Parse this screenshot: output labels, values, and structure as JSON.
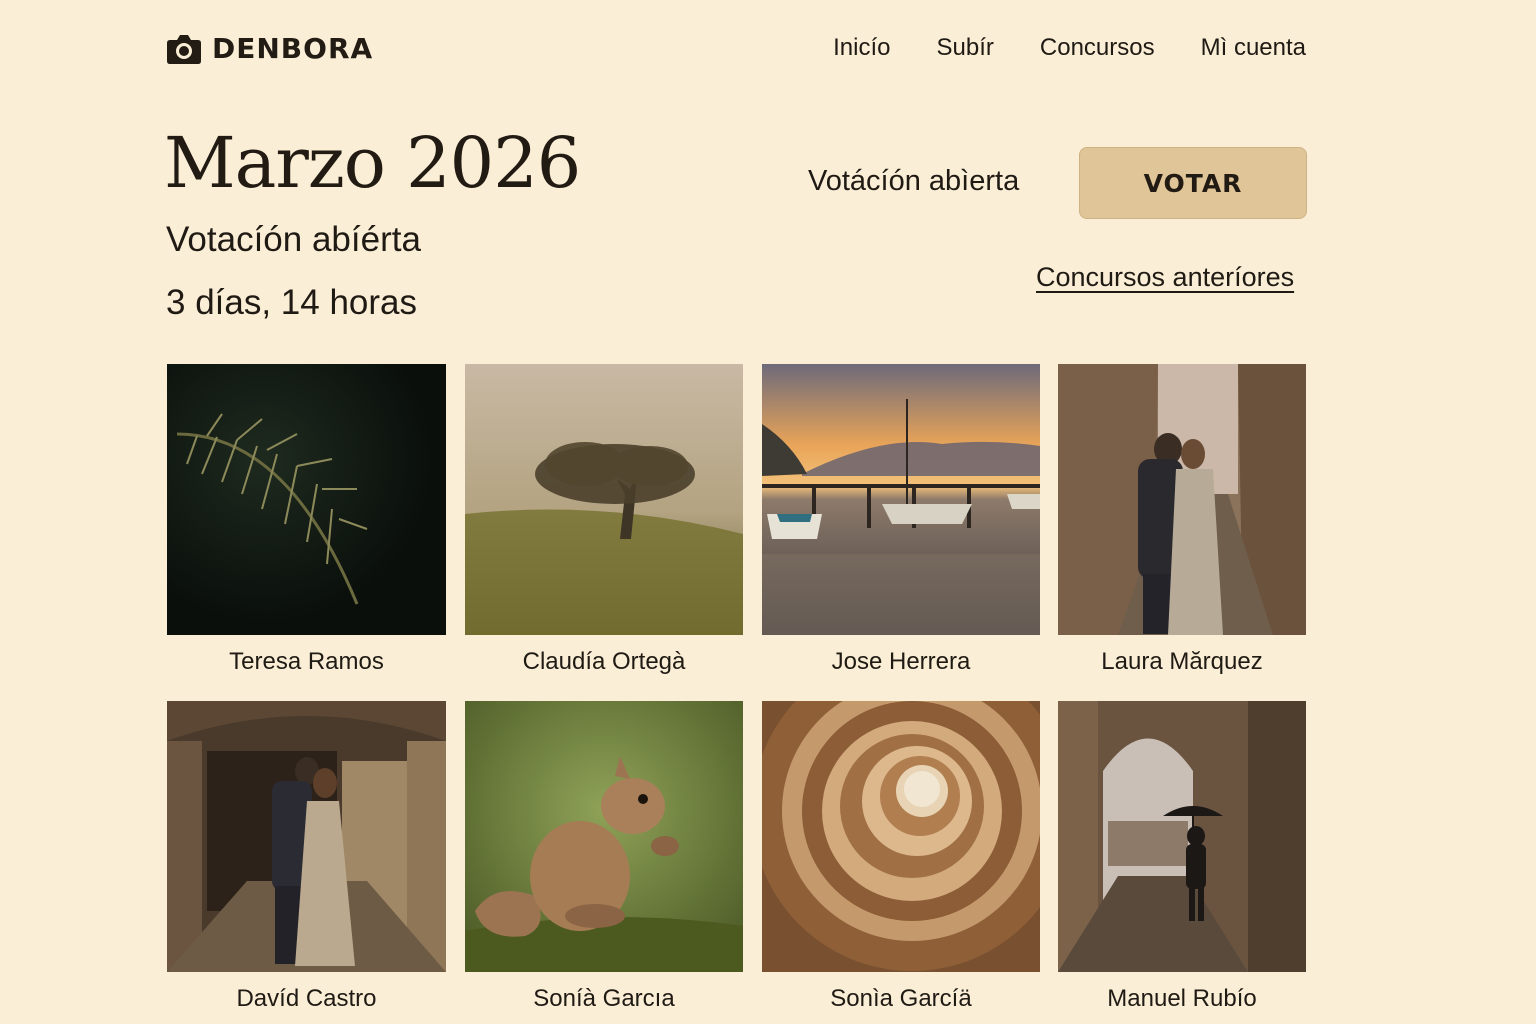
{
  "header": {
    "brand": "DENBORA",
    "nav": [
      "Inicío",
      "Subír",
      "Concursos",
      "Mì cuenta"
    ]
  },
  "contest": {
    "title": "Marzo 2026",
    "subtitle": "Votacíón abíérta",
    "countdown": "3 días, 14 horas",
    "status": "Votácíón abìerta",
    "vote_label": "VOTAR",
    "past_link": "Concursos anteríores"
  },
  "gallery": [
    {
      "author": "Teresa Ramos",
      "subject": "fern"
    },
    {
      "author": "Claudía Ortegà",
      "subject": "misty-tree"
    },
    {
      "author": "Jose Herrera",
      "subject": "sunset-harbor"
    },
    {
      "author": "Laura Mărquez",
      "subject": "couple-street"
    },
    {
      "author": "Davíd Castro",
      "subject": "couple-arcade"
    },
    {
      "author": "Soníà Garcıa",
      "subject": "squirrel"
    },
    {
      "author": "Sonìa Garcíä",
      "subject": "spiral-staircase"
    },
    {
      "author": "Manuel Rubío",
      "subject": "umbrella-arch"
    }
  ],
  "colors": {
    "background": "#fbeed6",
    "button": "#dfc598",
    "text": "#1f1a14"
  }
}
